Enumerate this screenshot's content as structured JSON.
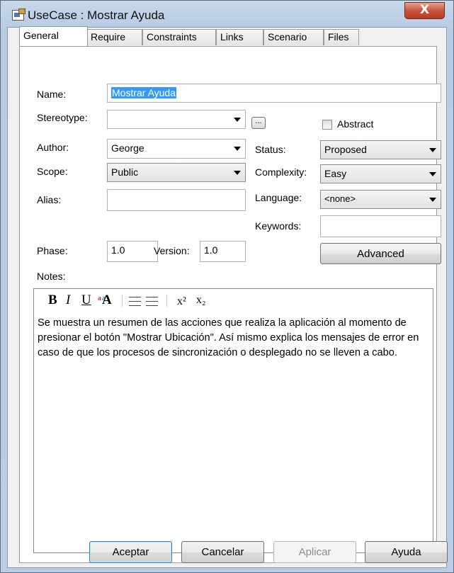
{
  "window": {
    "title": "UseCase : Mostrar Ayuda",
    "close_label": "X"
  },
  "tabs": [
    {
      "label": "General",
      "active": true
    },
    {
      "label": "Require"
    },
    {
      "label": "Constraints"
    },
    {
      "label": "Links"
    },
    {
      "label": "Scenario"
    },
    {
      "label": "Files"
    }
  ],
  "form": {
    "name_label": "Name:",
    "name_value": "Mostrar Ayuda",
    "stereotype_label": "Stereotype:",
    "stereotype_value": "",
    "stereotype_button": "...",
    "abstract_label": "Abstract",
    "abstract_checked": false,
    "author_label": "Author:",
    "author_value": "George",
    "status_label": "Status:",
    "status_value": "Proposed",
    "scope_label": "Scope:",
    "scope_value": "Public",
    "complexity_label": "Complexity:",
    "complexity_value": "Easy",
    "alias_label": "Alias:",
    "alias_value": "",
    "language_label": "Language:",
    "language_value": "<none>",
    "keywords_label": "Keywords:",
    "keywords_value": "",
    "phase_label": "Phase:",
    "phase_value": "1.0",
    "version_label": "Version:",
    "version_value": "1.0",
    "advanced_button": "Advanced",
    "notes_label": "Notes:"
  },
  "notes": {
    "toolbar": {
      "bold": "B",
      "italic": "I",
      "underline": "U",
      "superscript": "x²",
      "subscript": "x₂",
      "icons": [
        "bold-icon",
        "italic-icon",
        "underline-icon",
        "font-color-icon",
        "bullet-list-icon",
        "numbered-list-icon",
        "superscript-icon",
        "subscript-icon"
      ]
    },
    "text": "Se muestra un resumen de las acciones que realiza la aplicación al momento de presionar el botón \"Mostrar Ubicación\". Así mismo explica los mensajes de error en caso de que los procesos de sincronización o desplegado no se lleven a cabo."
  },
  "buttons": {
    "ok": "Aceptar",
    "cancel": "Cancelar",
    "apply": "Aplicar",
    "help": "Ayuda"
  }
}
